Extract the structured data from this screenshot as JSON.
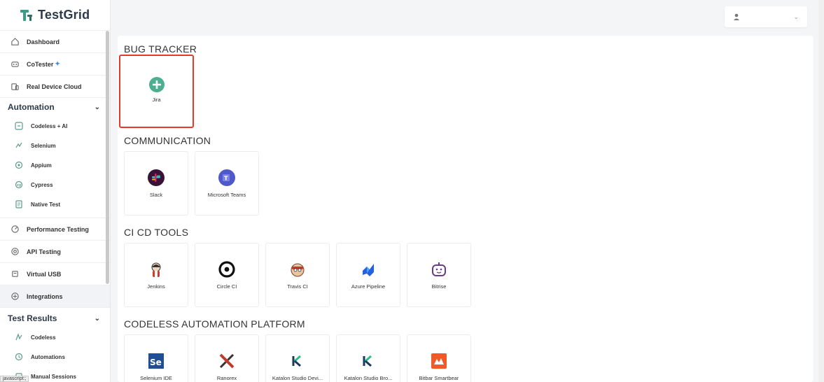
{
  "app": {
    "name": "TestGrid"
  },
  "sidebar": {
    "top_items": [
      {
        "label": "Dashboard",
        "icon": "home-icon"
      },
      {
        "label": "CoTester",
        "icon": "robot-icon"
      },
      {
        "label": "Real Device Cloud",
        "icon": "devices-icon"
      }
    ],
    "automation": {
      "title": "Automation",
      "items": [
        {
          "label": "Codeless + AI",
          "icon": "codeless-icon"
        },
        {
          "label": "Selenium",
          "icon": "selenium-icon"
        },
        {
          "label": "Appium",
          "icon": "appium-icon"
        },
        {
          "label": "Cypress",
          "icon": "cypress-icon"
        },
        {
          "label": "Native Test",
          "icon": "native-test-icon"
        }
      ]
    },
    "mid_items": [
      {
        "label": "Performance Testing",
        "icon": "gauge-icon"
      },
      {
        "label": "API Testing",
        "icon": "api-icon"
      },
      {
        "label": "Virtual USB",
        "icon": "usb-icon"
      },
      {
        "label": "Integrations",
        "icon": "integrations-icon",
        "active": true
      }
    ],
    "test_results": {
      "title": "Test Results",
      "items": [
        {
          "label": "Codeless",
          "icon": "codeless-results-icon"
        },
        {
          "label": "Automations",
          "icon": "clock-icon"
        },
        {
          "label": "Manual Sessions",
          "icon": "manual-icon"
        }
      ]
    }
  },
  "header": {
    "user_icon": "user-icon"
  },
  "groups": [
    {
      "title": "BUG TRACKER",
      "cards": [
        {
          "label": "Jira",
          "icon": "add-icon"
        }
      ]
    },
    {
      "title": "COMMUNICATION",
      "cards": [
        {
          "label": "Slack",
          "icon": "slack-icon"
        },
        {
          "label": "Microsoft Teams",
          "icon": "teams-icon"
        }
      ]
    },
    {
      "title": "CI CD TOOLS",
      "cards": [
        {
          "label": "Jenkins",
          "icon": "jenkins-icon"
        },
        {
          "label": "Circle CI",
          "icon": "circleci-icon"
        },
        {
          "label": "Travis CI",
          "icon": "travis-icon"
        },
        {
          "label": "Azure Pipeline",
          "icon": "azure-icon"
        },
        {
          "label": "Bitrise",
          "icon": "bitrise-icon"
        }
      ]
    },
    {
      "title": "CODELESS AUTOMATION PLATFORM",
      "cards": [
        {
          "label": "Selenium IDE",
          "icon": "selenium-ide-icon"
        },
        {
          "label": "Ranorex",
          "icon": "ranorex-icon"
        },
        {
          "label": "Katalon Studio Devi...",
          "icon": "katalon-icon"
        },
        {
          "label": "Katalon Studio Bro...",
          "icon": "katalon-icon"
        },
        {
          "label": "Bitbar Smartbear",
          "icon": "bitbar-icon"
        }
      ]
    }
  ],
  "status_bar": {
    "text": "javascript:;"
  },
  "colors": {
    "accent": "#4caf8f",
    "highlight": "#e53a2a"
  }
}
